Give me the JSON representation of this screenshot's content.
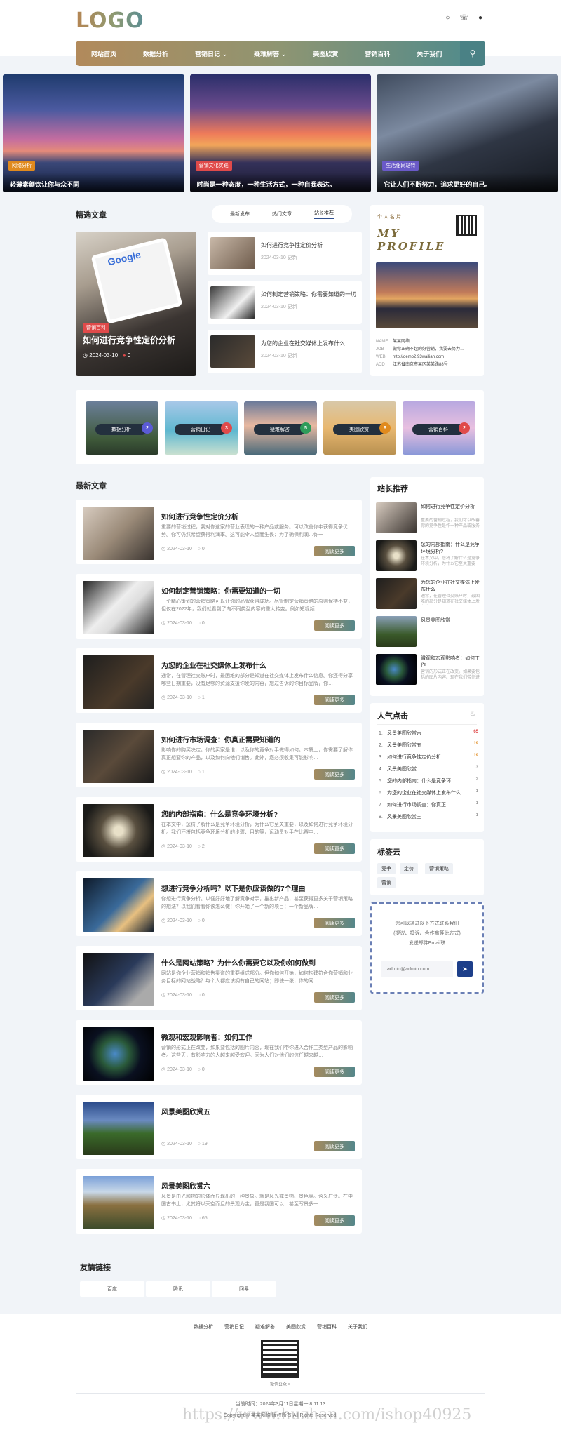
{
  "header": {
    "logo": "LOGO",
    "icons": [
      "bell-icon",
      "phone-icon",
      "wechat-icon"
    ]
  },
  "nav": {
    "items": [
      "网站首页",
      "数据分析",
      "营销日记",
      "疑难解答",
      "美图欣赏",
      "营销百科",
      "关于我们"
    ],
    "dropdown_marks": [
      "",
      "",
      "⌄",
      "⌄",
      "",
      "",
      ""
    ]
  },
  "banners": [
    {
      "tag": "网络分析",
      "caption": "轻薄素颜饮让你与众不同",
      "tag_color": "#e08a1e"
    },
    {
      "tag": "营销文化实践",
      "caption": "时尚是一种态度，一种生活方式，一种自我表达。",
      "tag_color": "#e04a4a"
    },
    {
      "tag": "生活化网站特",
      "caption": "它让人们不断努力，追求更好的自己。",
      "tag_color": "#6a5ac8"
    }
  ],
  "featured": {
    "title": "精选文章",
    "tabs": [
      "最新发布",
      "热门文章",
      "站长推荐"
    ],
    "main": {
      "tag": "营销百科",
      "title": "如何进行竞争性定价分析",
      "date": "2024-03-10",
      "count": "0",
      "brand": "Google"
    },
    "list": [
      {
        "title": "如何进行竞争性定价分析",
        "date": "2024-03-10 更新"
      },
      {
        "title": "如何制定营销策略：你需要知道的一切",
        "date": "2024-03-10 更新"
      },
      {
        "title": "为您的企业在社交媒体上发布什么",
        "date": "2024-03-10 更新"
      }
    ]
  },
  "profile": {
    "label": "个人名片",
    "heading1": "MY",
    "heading2": "PROFILE",
    "rows": [
      {
        "k": "NAME",
        "v": "某某网络"
      },
      {
        "k": "JOB",
        "v": "做你正确不起的好营销，我要去努力…"
      },
      {
        "k": "WEB",
        "v": "http://demo2.93wailian.com"
      },
      {
        "k": "ADD",
        "v": "江苏省南京市某区某某路88号"
      }
    ]
  },
  "categories": [
    {
      "label": "数据分析",
      "count": "2",
      "color": "#5b5bd6"
    },
    {
      "label": "营销日记",
      "count": "3",
      "color": "#e04a4a"
    },
    {
      "label": "疑难解答",
      "count": "5",
      "color": "#2e9c5a"
    },
    {
      "label": "美图欣赏",
      "count": "6",
      "color": "#e08a1e"
    },
    {
      "label": "营销百科",
      "count": "2",
      "color": "#e04a4a"
    }
  ],
  "latest": {
    "title": "最新文章",
    "btn": "阅读更多",
    "posts": [
      {
        "title": "如何进行竞争性定价分析",
        "excerpt": "重要的营销过程，我对你这家的营业表现的一种产品或服务。可以改善你中获得竞争优势。你可仍然希望获得利润率。这可能令人望而生畏；为了确保利润…你一",
        "date": "2024-03-10",
        "count": "0"
      },
      {
        "title": "如何制定营销策略：你需要知道的一切",
        "excerpt": "一个精心策划的营销策略可以让你的品牌获得成功。尽管制定营销策略的原则保持不变，但仅在2022年，我们就看到了向不同类型内容的重大转变。例如短视频…",
        "date": "2024-03-10",
        "count": "0"
      },
      {
        "title": "为您的企业在社交媒体上发布什么",
        "excerpt": "通常，在管理社交账户时，最困难的部分是知道在社交媒体上发布什么信息。你还得分享哪些日期重要，没有足够的资源支援你发的内容，想过告诉的你目标品牌，你…",
        "date": "2024-03-10",
        "count": "1"
      },
      {
        "title": "如何进行市场调查：你真正需要知道的",
        "excerpt": "影响你的购买决定。你的买家是谁，以及你的竞争对手做得如何。本质上，你需要了解你真正想要你的产品，以及如何向他们销售。此外，您必须收集可能影响…",
        "date": "2024-03-10",
        "count": "1"
      },
      {
        "title": "您的内部指南：什么是竞争环境分析?",
        "excerpt": "在本文中，您将了解什么是竞争环境分析，为什么它至关重要，以及如何进行竞争环境分析。我们还将包括竞争环境分析的步骤、目的等，运动员对手在比赛中…",
        "date": "2024-03-10",
        "count": "2"
      },
      {
        "title": "想进行竞争分析吗？以下是你应该做的7个理由",
        "excerpt": "你想进行竞争分析。以便好好地了解竞争对手，推出新产品，甚至获得更多关于营销策略的想法？以我们看看你该怎么做！你开始了一个新的项目：一个新品牌…",
        "date": "2024-03-10",
        "count": "0"
      },
      {
        "title": "什么是网站策略？为什么你需要它以及你如何做到",
        "excerpt": "网站是你企业营销和销售渠道的重要组成部分。但你如何开始，如何构建符合你营销和业务目标的网站战略？每个人都应该拥有自己的网站；即使一张，你的网…",
        "date": "2024-03-10",
        "count": "0"
      },
      {
        "title": "微观和宏观影响者：如何工作",
        "excerpt": "营销的形式正在改变，如果要包括的图片内容，现在我们带你进入合作主类型产品的影响者。这些天，有影响力的人越来越受欢迎。因为人们对他们的信任越来越…",
        "date": "2024-03-10",
        "count": "0"
      },
      {
        "title": "风景美图欣赏五",
        "excerpt": "",
        "date": "2024-03-10",
        "count": "19"
      },
      {
        "title": "风景美图欣赏六",
        "excerpt": "风景是由光和物的形体而显现出的一种景象。就是风光或景物、景色等。含义广泛。在中国古书上，尤其将以天空而且的景观为主，更是我国可以…甚至写景多一",
        "date": "2024-03-10",
        "count": "65"
      }
    ]
  },
  "recommend": {
    "title": "站长推荐",
    "items": [
      {
        "title": "如何进行竞争性定价分析",
        "excerpt": "重要的营销过程，我们可以改善你的竞争性是作一种产品或服务"
      },
      {
        "title": "您的内部指南：什么是竞争环境分析?",
        "excerpt": "在本文中，您将了解什么是竞争环境分析，为什么它至关重要"
      },
      {
        "title": "为您的企业在社交媒体上发布什么",
        "excerpt": "通常，在管理社交账户时，最困难的部分是知道在社交媒体上发布什么"
      },
      {
        "title": "风景美图欣赏",
        "excerpt": ""
      },
      {
        "title": "微观和宏观影响者：如何工作",
        "excerpt": "营销的形式正在改变。如果要包括的图片内容。现在我们带你进入"
      }
    ]
  },
  "hot": {
    "title": "人气点击",
    "items": [
      {
        "n": "1.",
        "title": "风景美图欣赏六",
        "count": "65",
        "color": "#e04a4a"
      },
      {
        "n": "2.",
        "title": "风景美图欣赏五",
        "count": "19",
        "color": "#e08a1e"
      },
      {
        "n": "3.",
        "title": "如何进行竞争性定价分析",
        "count": "19",
        "color": "#e08a1e"
      },
      {
        "n": "4.",
        "title": "风景美图欣赏",
        "count": "3",
        "color": "#999999"
      },
      {
        "n": "5.",
        "title": "您的内部指南：什么是竞争环…",
        "count": "2",
        "color": "#999999"
      },
      {
        "n": "6.",
        "title": "为您的企业在社交媒体上发布什么",
        "count": "1",
        "color": "#999999"
      },
      {
        "n": "7.",
        "title": "如何进行市场调查：你真正…",
        "count": "1",
        "color": "#999999"
      },
      {
        "n": "8.",
        "title": "风景美图欣赏三",
        "count": "1",
        "color": "#999999"
      }
    ]
  },
  "tags": {
    "title": "标签云",
    "items": [
      "竞争",
      "定价",
      "营销策略",
      "营销"
    ]
  },
  "mail": {
    "line1": "您可以通过以下方式联系我们",
    "line2": "(提议、投诉、合作商等此方式)",
    "line3": "发送邮件Email联",
    "placeholder": "admin@admin.com"
  },
  "links": {
    "title": "友情链接",
    "items": [
      "百度",
      "腾讯",
      "网易"
    ]
  },
  "footer": {
    "nav": [
      "数据分析",
      "营销日记",
      "疑难解答",
      "美图欣赏",
      "营销百科",
      "关于我们"
    ],
    "qr_label": "微信公众号",
    "time": "当前时间：2024年3月11日星期一 8:11:13",
    "copyright": "Copyright © 某某网络 版权所有 All Rights Reserved.",
    "watermark": "https://www.huzhan.com/ishop40925"
  }
}
